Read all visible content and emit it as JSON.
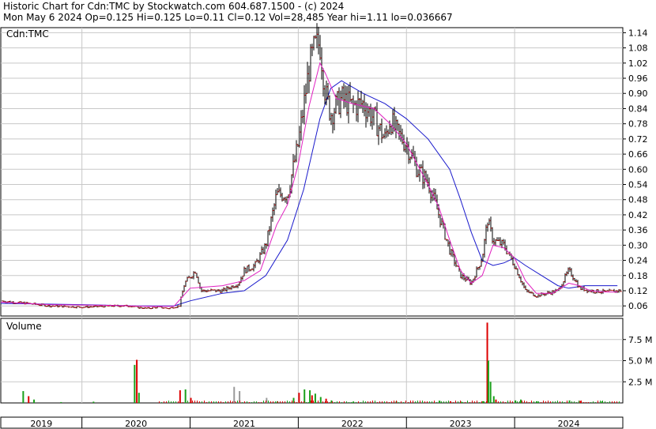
{
  "header": {
    "line1": "Historic Chart for Cdn:TMC by Stockwatch.com 604.687.1500 - (c) 2024",
    "line2": "Mon May  6 2024  Op=0.125  Hi=0.125  Lo=0.11  Cl=0.12  Vol=28,485  Year hi=1.11  lo=0.036667"
  },
  "price_panel_label": "Cdn:TMC",
  "volume_panel_label": "Volume",
  "colors": {
    "price_bar": "#000000",
    "close_tick": "#cc0000",
    "ma_short": "#e020c0",
    "ma_long": "#1a1acc",
    "vol_up": "#1aa01a",
    "vol_down": "#dd0000",
    "vol_flat": "#999999",
    "grid": "#c8c8c8"
  },
  "chart_data": {
    "type": "line",
    "price": {
      "ylim": [
        0.02,
        1.16
      ],
      "yticks": [
        "1.14",
        "1.08",
        "1.02",
        "0.96",
        "0.90",
        "0.84",
        "0.78",
        "0.72",
        "0.66",
        "0.60",
        "0.54",
        "0.48",
        "0.42",
        "0.36",
        "0.30",
        "0.24",
        "0.18",
        "0.12",
        "0.06"
      ],
      "xlim": [
        2018.75,
        2024.5
      ],
      "series": [
        {
          "role": "price",
          "points": [
            [
              2018.75,
              0.08
            ],
            [
              2018.85,
              0.075
            ],
            [
              2019.0,
              0.07
            ],
            [
              2019.2,
              0.06
            ],
            [
              2019.5,
              0.055
            ],
            [
              2019.8,
              0.06
            ],
            [
              2019.95,
              0.06
            ],
            [
              2020.0,
              0.055
            ],
            [
              2020.1,
              0.05
            ],
            [
              2020.2,
              0.055
            ],
            [
              2020.3,
              0.05
            ],
            [
              2020.4,
              0.06
            ],
            [
              2020.45,
              0.15
            ],
            [
              2020.55,
              0.2
            ],
            [
              2020.6,
              0.12
            ],
            [
              2020.8,
              0.12
            ],
            [
              2020.95,
              0.15
            ],
            [
              2021.0,
              0.2
            ],
            [
              2021.1,
              0.22
            ],
            [
              2021.2,
              0.3
            ],
            [
              2021.3,
              0.5
            ],
            [
              2021.4,
              0.5
            ],
            [
              2021.5,
              0.7
            ],
            [
              2021.6,
              1.0
            ],
            [
              2021.65,
              1.08
            ],
            [
              2021.7,
              1.1
            ],
            [
              2021.75,
              0.9
            ],
            [
              2021.8,
              0.82
            ],
            [
              2021.9,
              0.88
            ],
            [
              2022.0,
              0.85
            ],
            [
              2022.1,
              0.86
            ],
            [
              2022.2,
              0.8
            ],
            [
              2022.3,
              0.72
            ],
            [
              2022.35,
              0.8
            ],
            [
              2022.4,
              0.75
            ],
            [
              2022.5,
              0.7
            ],
            [
              2022.6,
              0.6
            ],
            [
              2022.7,
              0.55
            ],
            [
              2022.8,
              0.42
            ],
            [
              2022.9,
              0.28
            ],
            [
              2023.0,
              0.18
            ],
            [
              2023.1,
              0.15
            ],
            [
              2023.2,
              0.25
            ],
            [
              2023.25,
              0.4
            ],
            [
              2023.3,
              0.32
            ],
            [
              2023.4,
              0.3
            ],
            [
              2023.5,
              0.22
            ],
            [
              2023.6,
              0.12
            ],
            [
              2023.7,
              0.1
            ],
            [
              2023.8,
              0.11
            ],
            [
              2023.9,
              0.12
            ],
            [
              2024.0,
              0.2
            ],
            [
              2024.05,
              0.17
            ],
            [
              2024.1,
              0.13
            ],
            [
              2024.2,
              0.12
            ],
            [
              2024.35,
              0.115
            ],
            [
              2024.45,
              0.12
            ]
          ]
        },
        {
          "role": "short moving average",
          "points": [
            [
              2018.75,
              0.075
            ],
            [
              2019.2,
              0.065
            ],
            [
              2019.8,
              0.062
            ],
            [
              2020.1,
              0.058
            ],
            [
              2020.35,
              0.058
            ],
            [
              2020.5,
              0.13
            ],
            [
              2020.8,
              0.14
            ],
            [
              2021.0,
              0.16
            ],
            [
              2021.15,
              0.2
            ],
            [
              2021.3,
              0.38
            ],
            [
              2021.4,
              0.46
            ],
            [
              2021.5,
              0.62
            ],
            [
              2021.6,
              0.85
            ],
            [
              2021.7,
              1.02
            ],
            [
              2021.75,
              0.98
            ],
            [
              2021.85,
              0.88
            ],
            [
              2022.0,
              0.86
            ],
            [
              2022.2,
              0.84
            ],
            [
              2022.35,
              0.78
            ],
            [
              2022.5,
              0.7
            ],
            [
              2022.6,
              0.62
            ],
            [
              2022.7,
              0.54
            ],
            [
              2022.8,
              0.45
            ],
            [
              2022.9,
              0.32
            ],
            [
              2023.0,
              0.2
            ],
            [
              2023.1,
              0.15
            ],
            [
              2023.2,
              0.18
            ],
            [
              2023.3,
              0.3
            ],
            [
              2023.4,
              0.29
            ],
            [
              2023.5,
              0.25
            ],
            [
              2023.6,
              0.16
            ],
            [
              2023.7,
              0.11
            ],
            [
              2023.85,
              0.11
            ],
            [
              2024.0,
              0.15
            ],
            [
              2024.1,
              0.14
            ],
            [
              2024.2,
              0.12
            ],
            [
              2024.35,
              0.115
            ],
            [
              2024.45,
              0.115
            ]
          ]
        },
        {
          "role": "long moving average",
          "points": [
            [
              2018.75,
              0.07
            ],
            [
              2019.5,
              0.065
            ],
            [
              2020.0,
              0.06
            ],
            [
              2020.35,
              0.06
            ],
            [
              2020.5,
              0.08
            ],
            [
              2020.8,
              0.11
            ],
            [
              2021.0,
              0.12
            ],
            [
              2021.2,
              0.18
            ],
            [
              2021.4,
              0.32
            ],
            [
              2021.55,
              0.52
            ],
            [
              2021.7,
              0.8
            ],
            [
              2021.8,
              0.92
            ],
            [
              2021.9,
              0.95
            ],
            [
              2022.1,
              0.9
            ],
            [
              2022.3,
              0.86
            ],
            [
              2022.5,
              0.8
            ],
            [
              2022.7,
              0.72
            ],
            [
              2022.9,
              0.6
            ],
            [
              2023.0,
              0.48
            ],
            [
              2023.1,
              0.35
            ],
            [
              2023.2,
              0.24
            ],
            [
              2023.3,
              0.22
            ],
            [
              2023.4,
              0.23
            ],
            [
              2023.5,
              0.25
            ],
            [
              2023.6,
              0.22
            ],
            [
              2023.75,
              0.18
            ],
            [
              2023.9,
              0.14
            ],
            [
              2024.0,
              0.13
            ],
            [
              2024.15,
              0.14
            ],
            [
              2024.3,
              0.14
            ],
            [
              2024.45,
              0.14
            ]
          ]
        }
      ]
    },
    "volume": {
      "ylim": [
        0,
        10000000
      ],
      "yticks": [
        "7.5 M",
        "5.0 M",
        "2.5 M"
      ],
      "bars": [
        [
          2018.95,
          1400000,
          "up"
        ],
        [
          2019.0,
          800000,
          "down"
        ],
        [
          2019.05,
          400000,
          "up"
        ],
        [
          2019.3,
          100000,
          "up"
        ],
        [
          2019.6,
          150000,
          "up"
        ],
        [
          2019.98,
          4500000,
          "up"
        ],
        [
          2020.0,
          5100000,
          "down"
        ],
        [
          2020.02,
          1200000,
          "up"
        ],
        [
          2020.4,
          1500000,
          "down"
        ],
        [
          2020.45,
          1600000,
          "up"
        ],
        [
          2020.5,
          600000,
          "down"
        ],
        [
          2020.9,
          1900000,
          "flat"
        ],
        [
          2020.95,
          1400000,
          "flat"
        ],
        [
          2021.2,
          600000,
          "flat"
        ],
        [
          2021.3,
          200000,
          "up"
        ],
        [
          2021.45,
          600000,
          "up"
        ],
        [
          2021.5,
          1200000,
          "down"
        ],
        [
          2021.55,
          1600000,
          "up"
        ],
        [
          2021.6,
          1500000,
          "up"
        ],
        [
          2021.62,
          900000,
          "down"
        ],
        [
          2021.65,
          1100000,
          "up"
        ],
        [
          2021.7,
          700000,
          "up"
        ],
        [
          2021.75,
          500000,
          "down"
        ],
        [
          2021.8,
          300000,
          "up"
        ],
        [
          2022.0,
          150000,
          "up"
        ],
        [
          2022.4,
          200000,
          "up"
        ],
        [
          2022.8,
          250000,
          "up"
        ],
        [
          2022.9,
          200000,
          "down"
        ],
        [
          2023.0,
          150000,
          "up"
        ],
        [
          2023.2,
          200000,
          "up"
        ],
        [
          2023.24,
          9500000,
          "down"
        ],
        [
          2023.25,
          5000000,
          "up"
        ],
        [
          2023.27,
          2500000,
          "up"
        ],
        [
          2023.3,
          800000,
          "up"
        ],
        [
          2023.32,
          400000,
          "down"
        ],
        [
          2023.5,
          300000,
          "up"
        ],
        [
          2023.55,
          400000,
          "up"
        ],
        [
          2023.7,
          200000,
          "up"
        ],
        [
          2024.0,
          300000,
          "up"
        ],
        [
          2024.1,
          250000,
          "down"
        ],
        [
          2024.3,
          200000,
          "up"
        ]
      ]
    },
    "years": [
      {
        "label": "2019",
        "start": 2018.75,
        "end": 2019.5
      },
      {
        "label": "2020",
        "start": 2019.5,
        "end": 2020.5
      },
      {
        "label": "2021",
        "start": 2020.5,
        "end": 2021.5
      },
      {
        "label": "2022",
        "start": 2021.5,
        "end": 2022.5
      },
      {
        "label": "2023",
        "start": 2022.5,
        "end": 2023.5
      },
      {
        "label": "2024",
        "start": 2023.5,
        "end": 2024.5
      }
    ],
    "year_boundaries": [
      2019.5,
      2020.5,
      2021.5,
      2022.5,
      2023.5
    ]
  }
}
